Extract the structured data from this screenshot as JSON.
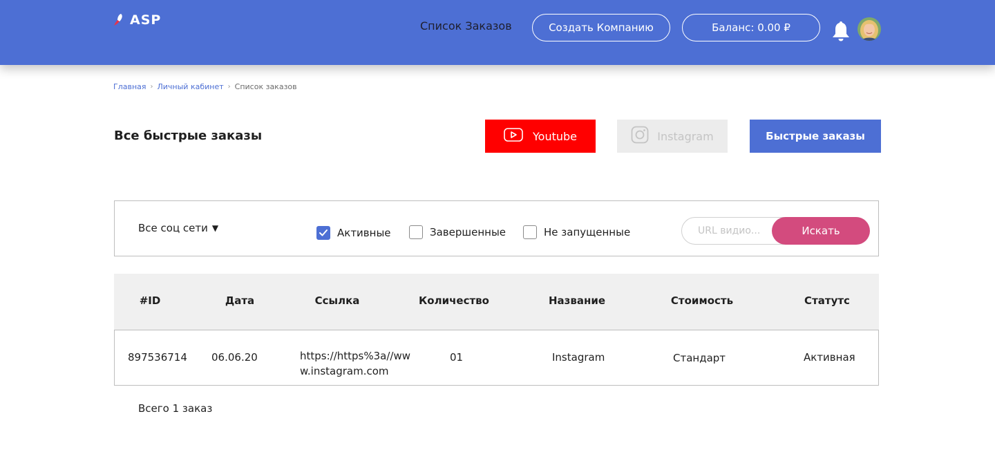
{
  "header": {
    "logo_text": "ASP",
    "nav_orders": "Список Заказов",
    "create_company": "Создать Компанию",
    "balance": "Баланс: 0.00 ₽"
  },
  "breadcrumb": {
    "items": [
      "Главная",
      "Личный кабинет",
      "Список заказов"
    ]
  },
  "page": {
    "title": "Все быстрые заказы",
    "tabs": {
      "youtube": "Youtube",
      "instagram": "Instagram",
      "fast_orders": "Быстрые заказы"
    }
  },
  "filters": {
    "network_select": "Все соц сети",
    "active": "Активные",
    "finished": "Завершенные",
    "not_started": "Не запущенные",
    "active_checked": true,
    "search_placeholder": "URL видио...",
    "search_button": "Искать"
  },
  "table": {
    "headers": [
      "#ID",
      "Дата",
      "Ссылка",
      "Количество",
      "Название",
      "Стоимость",
      "Статутс"
    ],
    "rows": [
      {
        "id": "897536714",
        "date": "06.06.20",
        "link": "https://https%3a//www.instagram.com",
        "quantity": "01",
        "name": "Instagram",
        "cost": "Стандарт",
        "status": "Активная"
      }
    ]
  },
  "footer": {
    "total": "Всего 1 заказ"
  },
  "colors": {
    "brand": "#4d6fd4",
    "youtube": "#ff0000",
    "search_button": "#d34b7e"
  }
}
